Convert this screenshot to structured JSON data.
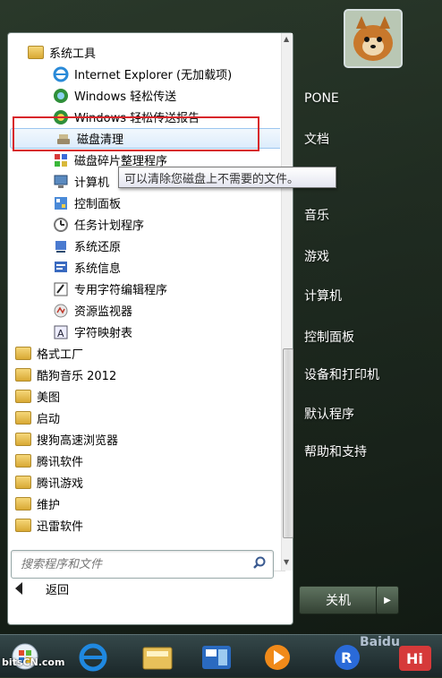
{
  "program_list": {
    "header": "系统工具",
    "sub_items": [
      {
        "label": "Internet Explorer (无加载项)",
        "icon": "ie-icon"
      },
      {
        "label": "Windows 轻松传送",
        "icon": "easy-transfer-icon"
      },
      {
        "label": "Windows 轻松传送报告",
        "icon": "easy-transfer-report-icon"
      },
      {
        "label": "磁盘清理",
        "icon": "disk-cleanup-icon"
      },
      {
        "label": "磁盘碎片整理程序",
        "icon": "defrag-icon"
      },
      {
        "label": "计算机",
        "icon": "computer-icon"
      },
      {
        "label": "控制面板",
        "icon": "control-panel-icon"
      },
      {
        "label": "任务计划程序",
        "icon": "task-scheduler-icon"
      },
      {
        "label": "系统还原",
        "icon": "system-restore-icon"
      },
      {
        "label": "系统信息",
        "icon": "system-info-icon"
      },
      {
        "label": "专用字符编辑程序",
        "icon": "char-editor-icon"
      },
      {
        "label": "资源监视器",
        "icon": "resource-monitor-icon"
      },
      {
        "label": "字符映射表",
        "icon": "char-map-icon"
      }
    ],
    "folders": [
      "格式工厂",
      "酷狗音乐 2012",
      "美图",
      "启动",
      "搜狗高速浏览器",
      "腾讯软件",
      "腾讯游戏",
      "维护",
      "迅雷软件"
    ],
    "back_label": "返回"
  },
  "tooltip": "可以清除您磁盘上不需要的文件。",
  "search": {
    "placeholder": "搜索程序和文件"
  },
  "right_pane": {
    "items": [
      "PONE",
      "文档",
      "音乐",
      "游戏",
      "计算机",
      "控制面板",
      "设备和打印机",
      "默认程序",
      "帮助和支持"
    ]
  },
  "shutdown": {
    "label": "关机"
  },
  "watermarks": {
    "left": "bitsCN.com",
    "right": "Baidu"
  },
  "colors": {
    "highlight_border": "#d8262b",
    "selection": "#dcecfc"
  }
}
